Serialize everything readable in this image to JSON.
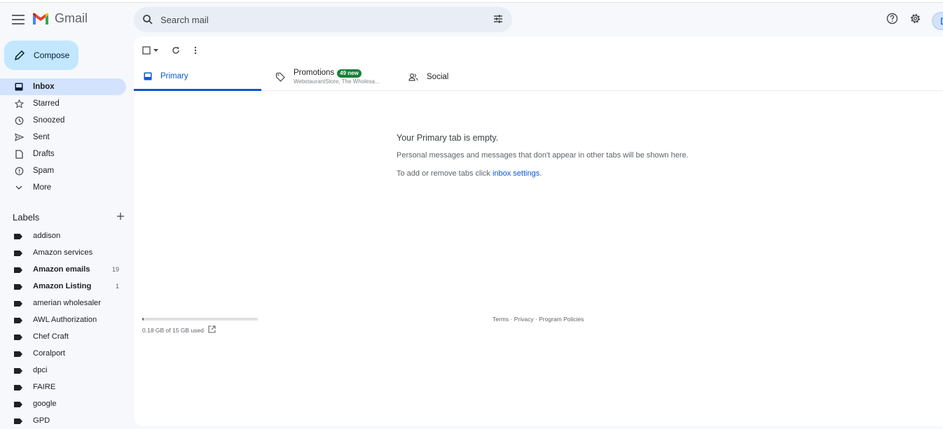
{
  "app": {
    "name": "Gmail"
  },
  "search": {
    "placeholder": "Search mail"
  },
  "header": {
    "avatar_initial": "D"
  },
  "compose": {
    "label": "Compose"
  },
  "nav": [
    {
      "label": "Inbox",
      "icon": "inbox-icon",
      "active": true
    },
    {
      "label": "Starred",
      "icon": "star-icon"
    },
    {
      "label": "Snoozed",
      "icon": "clock-icon"
    },
    {
      "label": "Sent",
      "icon": "send-icon"
    },
    {
      "label": "Drafts",
      "icon": "draft-icon"
    },
    {
      "label": "Spam",
      "icon": "spam-icon"
    },
    {
      "label": "More",
      "icon": "chevron-down-icon"
    }
  ],
  "labels": {
    "title": "Labels",
    "items": [
      {
        "label": "addison",
        "count": ""
      },
      {
        "label": "Amazon services",
        "count": ""
      },
      {
        "label": "Amazon emails",
        "count": "19",
        "bold": true
      },
      {
        "label": "Amazon Listing",
        "count": "1",
        "bold": true
      },
      {
        "label": "amerian wholesaler",
        "count": ""
      },
      {
        "label": "AWL Authorization",
        "count": ""
      },
      {
        "label": "Chef Craft",
        "count": ""
      },
      {
        "label": "Coralport",
        "count": ""
      },
      {
        "label": "dpci",
        "count": ""
      },
      {
        "label": "FAIRE",
        "count": ""
      },
      {
        "label": "google",
        "count": ""
      },
      {
        "label": "GPD",
        "count": ""
      }
    ]
  },
  "tabs": {
    "primary": "Primary",
    "promotions": {
      "label": "Promotions",
      "badge": "49 new",
      "subtitle": "WebstaurantStore, The Wholesa..."
    },
    "social": "Social"
  },
  "empty_state": {
    "title": "Your Primary tab is empty.",
    "line1": "Personal messages and messages that don't appear in other tabs will be shown here.",
    "line2_prefix": "To add or remove tabs click ",
    "line2_link": "inbox settings",
    "line2_suffix": "."
  },
  "storage": {
    "text": "0.18 GB of 15 GB used",
    "fraction": 0.012
  },
  "footer": {
    "terms": "Terms",
    "privacy": "Privacy",
    "policies": "Program Policies",
    "sep": " · "
  },
  "colors": {
    "accent": "#0b57d0",
    "compose_bg": "#c2e7ff",
    "active_nav": "#d3e3fd",
    "badge": "#188038"
  }
}
